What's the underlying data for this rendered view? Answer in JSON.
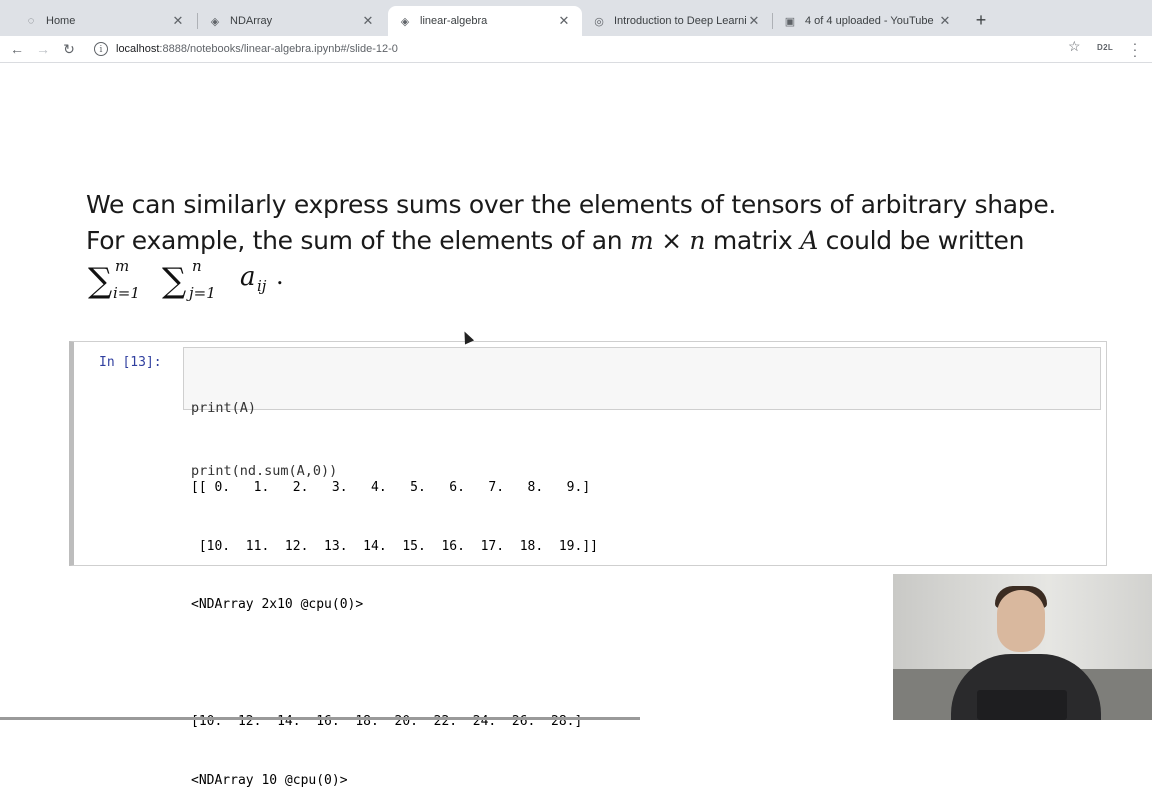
{
  "browser": {
    "tabs": [
      {
        "title": "Home",
        "icon": "jupyter-icon",
        "active": false
      },
      {
        "title": "NDArray",
        "icon": "notebook-icon",
        "active": false
      },
      {
        "title": "linear-algebra",
        "icon": "notebook-icon",
        "active": true
      },
      {
        "title": "Introduction to Deep Learning",
        "icon": "globe-icon",
        "active": false
      },
      {
        "title": "4 of 4 uploaded - YouTube",
        "icon": "youtube-icon",
        "active": false
      }
    ],
    "url_host": "localhost",
    "url_path": ":8888/notebooks/linear-algebra.ipynb#/slide-12-0",
    "extension_label": "D2L"
  },
  "slide": {
    "line1": "We can similarly express sums over the elements of tensors of arbitrary shape.",
    "line2_prefix": "For example, the sum of the elements of an",
    "m": "m",
    "times": "×",
    "n": "n",
    "line2_mid": "matrix",
    "A": "A",
    "line2_suffix": "could be written",
    "sum_sup1": "m",
    "sum_sub1": "i=1",
    "sum_sup2": "n",
    "sum_sub2": "j=1",
    "term": "a",
    "term_sub": "ij",
    "period": "."
  },
  "cell": {
    "prompt": "In [13]:",
    "code_line1": "print(A)",
    "code_line2": "print(nd.sum(A,0))",
    "output_lines": [
      "[[ 0.   1.   2.   3.   4.   5.   6.   7.   8.   9.]",
      " [10.  11.  12.  13.  14.  15.  16.  17.  18.  19.]]",
      "<NDArray 2x10 @cpu(0)>",
      "",
      "[10.  12.  14.  16.  18.  20.  22.  24.  26.  28.]",
      "<NDArray 10 @cpu(0)>"
    ]
  }
}
